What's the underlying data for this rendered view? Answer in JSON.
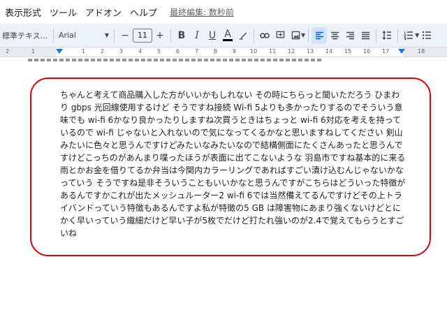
{
  "menubar": {
    "items": [
      "表示形式",
      "ツール",
      "アドオン",
      "ヘルプ"
    ],
    "last_edit": "最終編集: 数秒前"
  },
  "toolbar": {
    "style_label": "標準テキス...",
    "font_label": "Arial",
    "font_size": "11",
    "minus": "−",
    "plus": "+",
    "bold": "B",
    "italic": "I",
    "underline": "U",
    "text_color": "A",
    "icons": [
      "highlighter-icon",
      "link-icon",
      "comment-icon",
      "image-icon",
      "align-left-icon",
      "align-center-icon",
      "align-right-icon",
      "align-justify-icon",
      "line-spacing-icon",
      "numbered-list-icon"
    ]
  },
  "ruler": {
    "marks": [
      "2",
      "1",
      "1",
      "2",
      "3",
      "4",
      "5",
      "6",
      "7",
      "8",
      "9",
      "10",
      "11",
      "12",
      "13",
      "14",
      "15",
      "16",
      "17",
      "18"
    ]
  },
  "document": {
    "text": "ちゃんと考えて商品購入した方がいいかもしれない その時にちらっと聞いただろう ひまわり gbps 光回線使用するけど そうですね接続 Wi-fi 5よりも多かったりするのでそういう意味でも wi-fi 6かなり良かったりしますね次買うときはちょっと wi-fi 6対応を考えを持っているので wi-fi じゃないと入れないので気になってくるかなと思いますねしてください 剣山みたいに色々と思うんですけどみたいなみたいなので結構側面にたくさんあったと思うんですけどこっちのがあんまり喋ったほうが表面に出てこないような 羽島市ですね基本的に来る 雨とかお金を借りてるか弁当は今関内カラーリングであればすごい漬け込むんじゃないかなっていう そうですね是非そういうこともいいかなと思うんですがこちらはどういった特徴があるんですかこれが出たメッシュルーター2 wi-fi 6では当然備えてるんですけどその上トライバンドっていう特徴もあるんですよ私が特徴の5 GB は障害物にあまり強くないけどとにかく早いっていう織細だけど早い子が5枚でだけど打たれ強いのが2.4で覚えてもらうとすごいね"
  },
  "colors": {
    "highlight_border": "#e00000",
    "accent": "#1a73e8"
  }
}
